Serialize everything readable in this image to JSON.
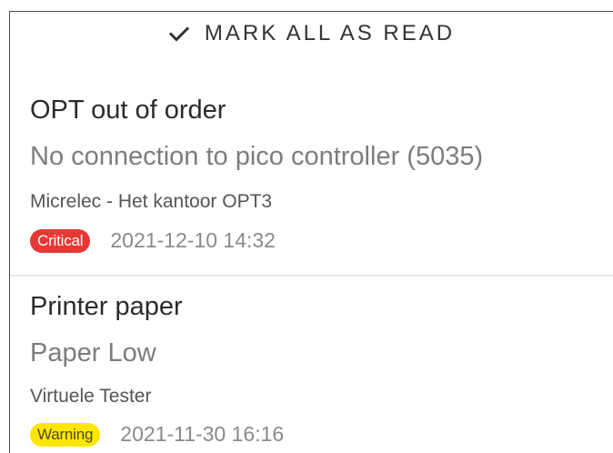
{
  "header": {
    "mark_all_label": "MARK ALL AS READ",
    "icon": "check-icon"
  },
  "notifications": [
    {
      "title": "OPT out of order",
      "message": "No connection to pico controller (5035)",
      "source": "Micrelec - Het kantoor OPT3",
      "severity": "Critical",
      "severity_color": "#e53935",
      "timestamp": "2021-12-10 14:32"
    },
    {
      "title": "Printer paper",
      "message": "Paper Low",
      "source": "Virtuele Tester",
      "severity": "Warning",
      "severity_color": "#ffe600",
      "timestamp": "2021-11-30 16:16"
    }
  ]
}
